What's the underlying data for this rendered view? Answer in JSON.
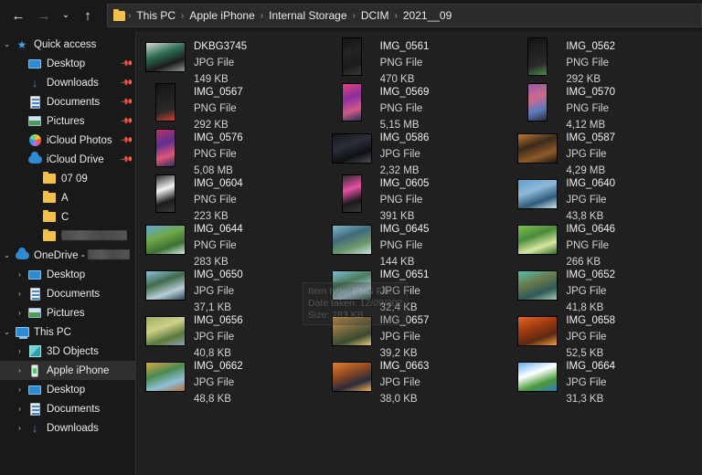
{
  "nav": {
    "back_icon": "back-arrow-icon",
    "forward_icon": "forward-arrow-icon",
    "recent_icon": "chevron-down-icon",
    "up_icon": "up-arrow-icon",
    "breadcrumbs": [
      "This PC",
      "Apple iPhone",
      "Internal Storage",
      "DCIM",
      "2021__09"
    ],
    "separator": "›"
  },
  "sidebar": {
    "sections": [
      {
        "label": "Quick access",
        "icon": "star-icon",
        "expanded": true,
        "chevron": "⌄",
        "items": [
          {
            "label": "Desktop",
            "icon": "monitor-icon",
            "pinned": true,
            "indent": 1
          },
          {
            "label": "Downloads",
            "icon": "download-icon",
            "pinned": true,
            "indent": 1
          },
          {
            "label": "Documents",
            "icon": "document-icon",
            "pinned": true,
            "indent": 1
          },
          {
            "label": "Pictures",
            "icon": "picture-icon",
            "pinned": true,
            "indent": 1
          },
          {
            "label": "iCloud Photos",
            "icon": "icloud-photos-icon",
            "pinned": true,
            "indent": 1
          },
          {
            "label": "iCloud Drive",
            "icon": "icloud-drive-icon",
            "pinned": true,
            "indent": 1
          },
          {
            "label": "07 09",
            "icon": "folder-icon",
            "pinned": false,
            "indent": 2
          },
          {
            "label": "A",
            "icon": "folder-icon",
            "pinned": false,
            "indent": 2
          },
          {
            "label": "C",
            "icon": "folder-icon",
            "pinned": false,
            "indent": 2
          },
          {
            "label": "",
            "icon": "folder-icon",
            "pinned": false,
            "indent": 2,
            "redacted": true
          }
        ]
      },
      {
        "label": "OneDrive - ",
        "icon": "cloud-icon",
        "expanded": true,
        "chevron": "⌄",
        "redacted_suffix": true,
        "items": [
          {
            "label": "Desktop",
            "icon": "monitor-icon",
            "chevron": "›",
            "indent": 1
          },
          {
            "label": "Documents",
            "icon": "document-icon",
            "chevron": "›",
            "indent": 1
          },
          {
            "label": "Pictures",
            "icon": "picture-icon",
            "chevron": "›",
            "indent": 1
          }
        ]
      },
      {
        "label": "This PC",
        "icon": "pc-icon",
        "expanded": true,
        "chevron": "⌄",
        "items": [
          {
            "label": "3D Objects",
            "icon": "3d-objects-icon",
            "chevron": "›",
            "indent": 1
          },
          {
            "label": "Apple iPhone",
            "icon": "phone-icon",
            "chevron": "›",
            "indent": 1,
            "selected": true
          },
          {
            "label": "Desktop",
            "icon": "monitor-icon",
            "chevron": "›",
            "indent": 1
          },
          {
            "label": "Documents",
            "icon": "document-icon",
            "chevron": "›",
            "indent": 1
          },
          {
            "label": "Downloads",
            "icon": "download-icon",
            "chevron": "›",
            "indent": 1
          }
        ]
      }
    ]
  },
  "tooltip": {
    "visible": true,
    "lines": [
      "Item type: PNG File",
      "Date taken: 12/09/202",
      "Size: 283 KB"
    ]
  },
  "files": [
    {
      "name": "DKBG3745",
      "type": "JPG File",
      "size": "149 KB",
      "orient": "land",
      "colors": [
        "#dcdcd6",
        "#2f6f55",
        "#1b1b1b",
        "#8f9a95"
      ]
    },
    {
      "name": "IMG_0567",
      "type": "PNG File",
      "size": "292 KB",
      "orient": "port",
      "colors": [
        "#141414",
        "#1f1f1f",
        "#2a2a2a",
        "#d0402f"
      ]
    },
    {
      "name": "IMG_0576",
      "type": "PNG File",
      "size": "5,08 MB",
      "orient": "port",
      "colors": [
        "#c0306a",
        "#5b2f8f",
        "#e0557a",
        "#2d2d5a"
      ]
    },
    {
      "name": "IMG_0604",
      "type": "PNG File",
      "size": "223 KB",
      "orient": "port",
      "colors": [
        "#2a2a2a",
        "#f2f2f2",
        "#1a1a1a",
        "#3a3a3a"
      ]
    },
    {
      "name": "IMG_0644",
      "type": "PNG File",
      "size": "283 KB",
      "orient": "land",
      "colors": [
        "#5fa8d8",
        "#6fa84a",
        "#3e7030",
        "#d8e8f0"
      ]
    },
    {
      "name": "IMG_0650",
      "type": "JPG File",
      "size": "37,1 KB",
      "orient": "land",
      "colors": [
        "#8fc3e2",
        "#3f6a4a",
        "#b8cdd8",
        "#2c4a58"
      ]
    },
    {
      "name": "IMG_0656",
      "type": "JPG File",
      "size": "40,8 KB",
      "orient": "land",
      "colors": [
        "#9aae5c",
        "#cfd08a",
        "#5a7a3a",
        "#8fa0b8"
      ]
    },
    {
      "name": "IMG_0662",
      "type": "JPG File",
      "size": "48,8 KB",
      "orient": "land",
      "colors": [
        "#d8a840",
        "#4a8a50",
        "#8fc0d8",
        "#b07030"
      ]
    },
    {
      "name": "IMG_0561",
      "type": "PNG File",
      "size": "470 KB",
      "orient": "port",
      "colors": [
        "#121212",
        "#242424",
        "#1a1a1a",
        "#3a3a3a"
      ]
    },
    {
      "name": "IMG_0569",
      "type": "PNG File",
      "size": "5,15 MB",
      "orient": "port",
      "colors": [
        "#e0407a",
        "#8f2f9f",
        "#d05a8a",
        "#203050"
      ]
    },
    {
      "name": "IMG_0586",
      "type": "JPG File",
      "size": "2,32 MB",
      "orient": "land",
      "colors": [
        "#14161c",
        "#2a2e38",
        "#0e1014",
        "#4a4e58"
      ]
    },
    {
      "name": "IMG_0605",
      "type": "PNG File",
      "size": "391 KB",
      "orient": "port",
      "colors": [
        "#2a2a2a",
        "#e84fa8",
        "#1a1a1a",
        "#3a3a3a"
      ]
    },
    {
      "name": "IMG_0645",
      "type": "PNG File",
      "size": "144 KB",
      "orient": "land",
      "colors": [
        "#7fb8cf",
        "#3f6a7a",
        "#6f9a6a",
        "#cfe0e8"
      ]
    },
    {
      "name": "IMG_0651",
      "type": "JPG File",
      "size": "32,4 KB",
      "orient": "land",
      "colors": [
        "#7fc0d8",
        "#4a7a5a",
        "#b0d0e0",
        "#3a5a48"
      ]
    },
    {
      "name": "IMG_0657",
      "type": "JPG File",
      "size": "39,2 KB",
      "orient": "land",
      "colors": [
        "#d8a050",
        "#7a6a40",
        "#3a4a30",
        "#e8c878"
      ]
    },
    {
      "name": "IMG_0663",
      "type": "JPG File",
      "size": "38,0 KB",
      "orient": "land",
      "colors": [
        "#e08030",
        "#8f4a20",
        "#2a2a3a",
        "#f0b050"
      ]
    },
    {
      "name": "IMG_0562",
      "type": "PNG File",
      "size": "292 KB",
      "orient": "port",
      "colors": [
        "#141414",
        "#202020",
        "#2a2a2a",
        "#4a8f4a"
      ]
    },
    {
      "name": "IMG_0570",
      "type": "PNG File",
      "size": "4,12 MB",
      "orient": "port",
      "colors": [
        "#8f5aa8",
        "#d06a8a",
        "#5a7ac0",
        "#2a2a3a"
      ]
    },
    {
      "name": "IMG_0587",
      "type": "JPG File",
      "size": "4,29 MB",
      "orient": "land",
      "colors": [
        "#c07a30",
        "#3a2a1a",
        "#8f5a28",
        "#1a1410"
      ]
    },
    {
      "name": "IMG_0640",
      "type": "JPG File",
      "size": "43,8 KB",
      "orient": "land",
      "colors": [
        "#5fa0d0",
        "#8fb8d8",
        "#2f5a78",
        "#cfe8f0"
      ]
    },
    {
      "name": "IMG_0646",
      "type": "PNG File",
      "size": "266 KB",
      "orient": "land",
      "colors": [
        "#7fc04a",
        "#4a8a3a",
        "#d8e8a0",
        "#2f6a2f"
      ]
    },
    {
      "name": "IMG_0652",
      "type": "JPG File",
      "size": "41,8 KB",
      "orient": "land",
      "colors": [
        "#4fc0b0",
        "#6a7a4a",
        "#2f5a58",
        "#a0c8b0"
      ]
    },
    {
      "name": "IMG_0658",
      "type": "JPG File",
      "size": "52,5 KB",
      "orient": "land",
      "colors": [
        "#e06820",
        "#a03a10",
        "#5a2a10",
        "#f0a040"
      ]
    },
    {
      "name": "IMG_0664",
      "type": "JPG File",
      "size": "31,3 KB",
      "orient": "land",
      "colors": [
        "#5fb0e8",
        "#ffffff",
        "#4a9a3a",
        "#2f7ac0"
      ]
    }
  ]
}
